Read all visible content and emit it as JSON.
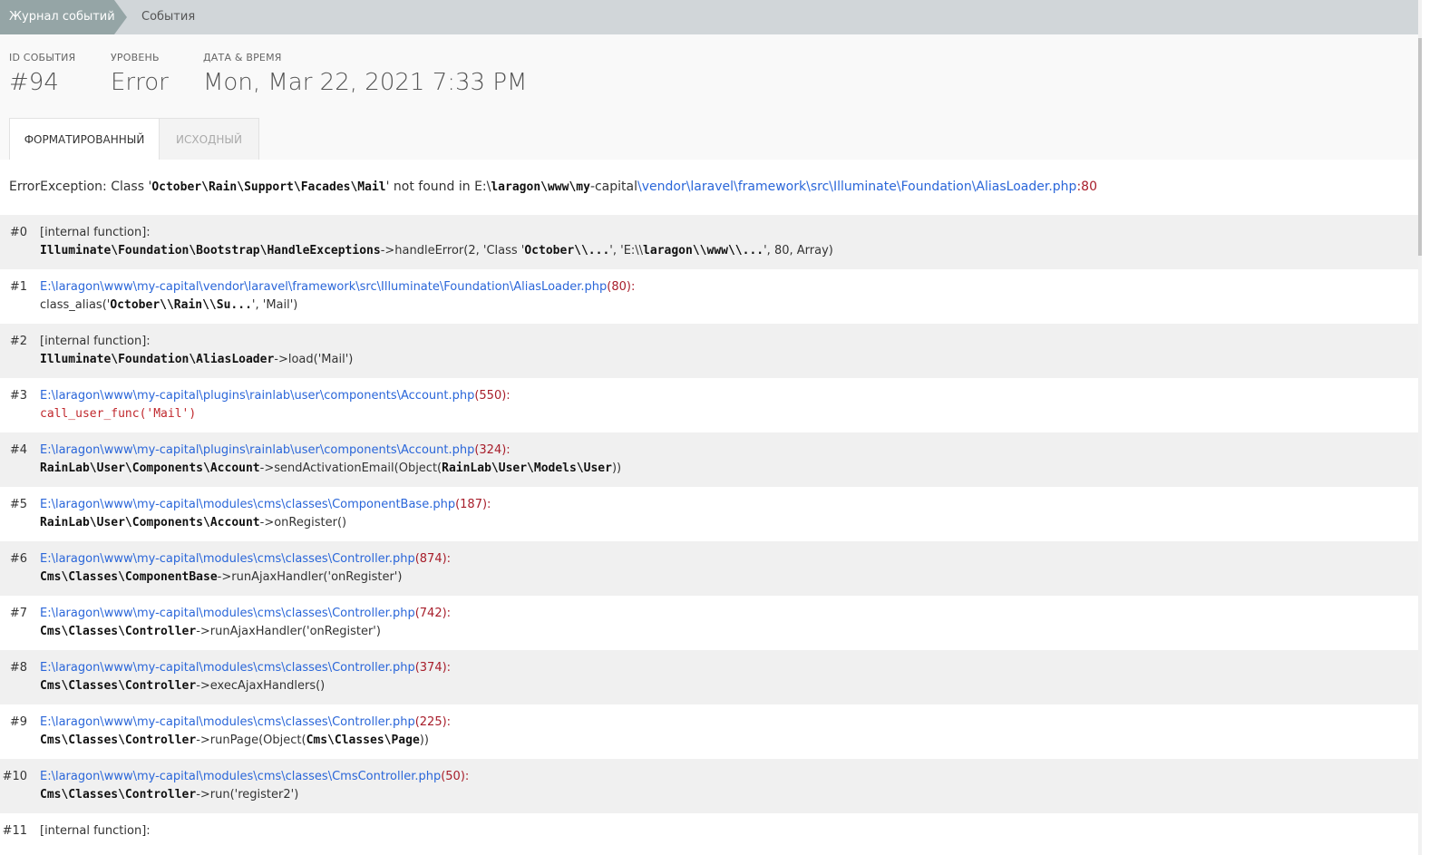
{
  "breadcrumb": {
    "parent": "Журнал событий",
    "current": "События"
  },
  "scoreboard": {
    "id_label": "ID СОБЫТИЯ",
    "id_value": "#94",
    "level_label": "УРОВЕНЬ",
    "level_value": "Error",
    "date_label": "ДАТА & ВРЕМЯ",
    "date_value": "Mon, Mar 22, 2021 7:33 PM"
  },
  "tabs": {
    "formatted": "ФОРМАТИРОВАННЫЙ",
    "raw": "ИСХОДНЫЙ"
  },
  "message": {
    "prefix": "ErrorException: Class '",
    "class_name": "October\\Rain\\Support\\Facades\\Mail",
    "middle": "' not found in E:\\",
    "path_bold1": "laragon\\www\\my",
    "path_plain": "-capital",
    "path_link": "\\vendor\\laravel\\framework\\src\\Illuminate\\Foundation\\AliasLoader.php",
    "sep": ":",
    "line": "80"
  },
  "frames": [
    {
      "num": "#0",
      "internal": "[internal function]:",
      "cls": "Illuminate\\Foundation\\Bootstrap\\HandleExceptions",
      "call": "->handleError(2, 'Class '",
      "arg1": "October\\\\...",
      "mid": "', 'E:\\\\",
      "arg2": "laragon\\\\www\\\\...",
      "end": "', 80, Array)"
    },
    {
      "num": "#1",
      "file": "E:\\laragon\\www\\my-capital\\vendor\\laravel\\framework\\src\\Illuminate\\Foundation\\AliasLoader.php",
      "line": "(80):",
      "pre": "class_alias('",
      "arg": "October\\\\Rain\\\\Su...",
      "post": "', 'Mail')"
    },
    {
      "num": "#2",
      "internal": "[internal function]:",
      "cls": "Illuminate\\Foundation\\AliasLoader",
      "call": "->load('Mail')"
    },
    {
      "num": "#3",
      "file": "E:\\laragon\\www\\my-capital\\plugins\\rainlab\\user\\components\\Account.php",
      "line": "(550):",
      "fn": "call_user_func(",
      "q1": "'",
      "str": "Mail",
      "q2": "'",
      "close": ")"
    },
    {
      "num": "#4",
      "file": "E:\\laragon\\www\\my-capital\\plugins\\rainlab\\user\\components\\Account.php",
      "line": "(324):",
      "cls": "RainLab\\User\\Components\\Account",
      "call": "->sendActivationEmail(Object(",
      "obj": "RainLab\\User\\Models\\User",
      "end": "))"
    },
    {
      "num": "#5",
      "file": "E:\\laragon\\www\\my-capital\\modules\\cms\\classes\\ComponentBase.php",
      "line": "(187):",
      "cls": "RainLab\\User\\Components\\Account",
      "call": "->onRegister()"
    },
    {
      "num": "#6",
      "file": "E:\\laragon\\www\\my-capital\\modules\\cms\\classes\\Controller.php",
      "line": "(874):",
      "cls": "Cms\\Classes\\ComponentBase",
      "call": "->runAjaxHandler('onRegister')"
    },
    {
      "num": "#7",
      "file": "E:\\laragon\\www\\my-capital\\modules\\cms\\classes\\Controller.php",
      "line": "(742):",
      "cls": "Cms\\Classes\\Controller",
      "call": "->runAjaxHandler('onRegister')"
    },
    {
      "num": "#8",
      "file": "E:\\laragon\\www\\my-capital\\modules\\cms\\classes\\Controller.php",
      "line": "(374):",
      "cls": "Cms\\Classes\\Controller",
      "call": "->execAjaxHandlers()"
    },
    {
      "num": "#9",
      "file": "E:\\laragon\\www\\my-capital\\modules\\cms\\classes\\Controller.php",
      "line": "(225):",
      "cls": "Cms\\Classes\\Controller",
      "call": "->runPage(Object(",
      "obj": "Cms\\Classes\\Page",
      "end": "))"
    },
    {
      "num": "#10",
      "file": "E:\\laragon\\www\\my-capital\\modules\\cms\\classes\\CmsController.php",
      "line": "(50):",
      "cls": "Cms\\Classes\\Controller",
      "call": "->run('register2')"
    },
    {
      "num": "#11",
      "internal": "[internal function]:"
    }
  ],
  "colors": {
    "breadcrumb_active": "#95a5a6",
    "breadcrumb_bar": "#d1d6d9",
    "link": "#2a66d9",
    "line_number": "#a71d2a",
    "string": "#2a8f2a",
    "code_red": "#c0282d"
  }
}
